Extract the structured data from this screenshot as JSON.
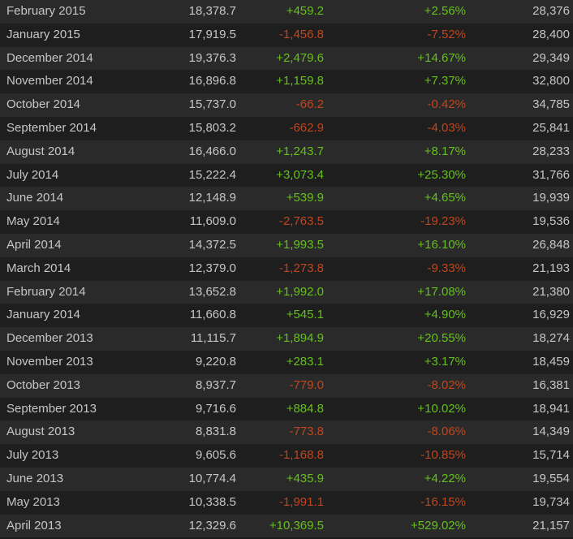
{
  "colors": {
    "positive": "#66c01c",
    "negative": "#c0461d",
    "text": "#c6c6c6",
    "row_odd": "#2a2a2a",
    "row_even": "#1e1e1e"
  },
  "rows": [
    {
      "month": "February 2015",
      "avg": "18,378.7",
      "gain": "+459.2",
      "pct": "+2.56%",
      "peak": "28,376",
      "trend": "pos"
    },
    {
      "month": "January 2015",
      "avg": "17,919.5",
      "gain": "-1,456.8",
      "pct": "-7.52%",
      "peak": "28,400",
      "trend": "neg"
    },
    {
      "month": "December 2014",
      "avg": "19,376.3",
      "gain": "+2,479.6",
      "pct": "+14.67%",
      "peak": "29,349",
      "trend": "pos"
    },
    {
      "month": "November 2014",
      "avg": "16,896.8",
      "gain": "+1,159.8",
      "pct": "+7.37%",
      "peak": "32,800",
      "trend": "pos"
    },
    {
      "month": "October 2014",
      "avg": "15,737.0",
      "gain": "-66.2",
      "pct": "-0.42%",
      "peak": "34,785",
      "trend": "neg"
    },
    {
      "month": "September 2014",
      "avg": "15,803.2",
      "gain": "-662.9",
      "pct": "-4.03%",
      "peak": "25,841",
      "trend": "neg"
    },
    {
      "month": "August 2014",
      "avg": "16,466.0",
      "gain": "+1,243.7",
      "pct": "+8.17%",
      "peak": "28,233",
      "trend": "pos"
    },
    {
      "month": "July 2014",
      "avg": "15,222.4",
      "gain": "+3,073.4",
      "pct": "+25.30%",
      "peak": "31,766",
      "trend": "pos"
    },
    {
      "month": "June 2014",
      "avg": "12,148.9",
      "gain": "+539.9",
      "pct": "+4.65%",
      "peak": "19,939",
      "trend": "pos"
    },
    {
      "month": "May 2014",
      "avg": "11,609.0",
      "gain": "-2,763.5",
      "pct": "-19.23%",
      "peak": "19,536",
      "trend": "neg"
    },
    {
      "month": "April 2014",
      "avg": "14,372.5",
      "gain": "+1,993.5",
      "pct": "+16.10%",
      "peak": "26,848",
      "trend": "pos"
    },
    {
      "month": "March 2014",
      "avg": "12,379.0",
      "gain": "-1,273.8",
      "pct": "-9.33%",
      "peak": "21,193",
      "trend": "neg"
    },
    {
      "month": "February 2014",
      "avg": "13,652.8",
      "gain": "+1,992.0",
      "pct": "+17.08%",
      "peak": "21,380",
      "trend": "pos"
    },
    {
      "month": "January 2014",
      "avg": "11,660.8",
      "gain": "+545.1",
      "pct": "+4.90%",
      "peak": "16,929",
      "trend": "pos"
    },
    {
      "month": "December 2013",
      "avg": "11,115.7",
      "gain": "+1,894.9",
      "pct": "+20.55%",
      "peak": "18,274",
      "trend": "pos"
    },
    {
      "month": "November 2013",
      "avg": "9,220.8",
      "gain": "+283.1",
      "pct": "+3.17%",
      "peak": "18,459",
      "trend": "pos"
    },
    {
      "month": "October 2013",
      "avg": "8,937.7",
      "gain": "-779.0",
      "pct": "-8.02%",
      "peak": "16,381",
      "trend": "neg"
    },
    {
      "month": "September 2013",
      "avg": "9,716.6",
      "gain": "+884.8",
      "pct": "+10.02%",
      "peak": "18,941",
      "trend": "pos"
    },
    {
      "month": "August 2013",
      "avg": "8,831.8",
      "gain": "-773.8",
      "pct": "-8.06%",
      "peak": "14,349",
      "trend": "neg"
    },
    {
      "month": "July 2013",
      "avg": "9,605.6",
      "gain": "-1,168.8",
      "pct": "-10.85%",
      "peak": "15,714",
      "trend": "neg"
    },
    {
      "month": "June 2013",
      "avg": "10,774.4",
      "gain": "+435.9",
      "pct": "+4.22%",
      "peak": "19,554",
      "trend": "pos"
    },
    {
      "month": "May 2013",
      "avg": "10,338.5",
      "gain": "-1,991.1",
      "pct": "-16.15%",
      "peak": "19,734",
      "trend": "neg"
    },
    {
      "month": "April 2013",
      "avg": "12,329.6",
      "gain": "+10,369.5",
      "pct": "+529.02%",
      "peak": "21,157",
      "trend": "pos"
    }
  ]
}
